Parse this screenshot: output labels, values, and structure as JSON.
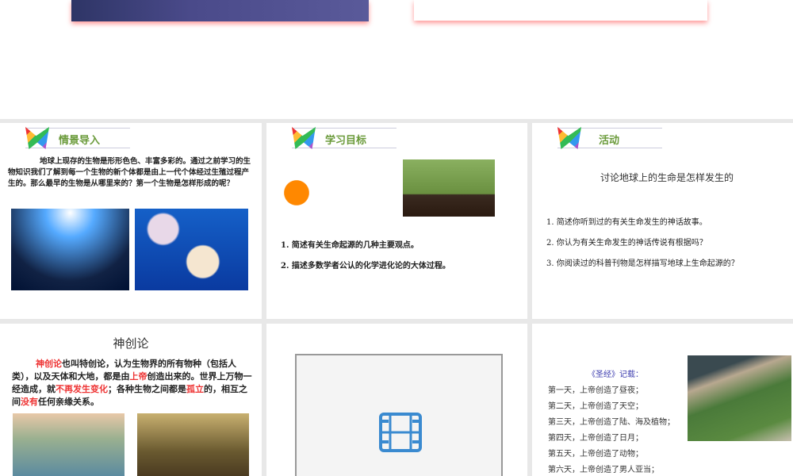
{
  "slides": {
    "s2": {
      "title": "情景导入",
      "body": "地球上现存的生物是形形色色、丰富多彩的。通过之前学习的生物知识我们了解到每一个生物的新个体都是由上一代个体经过生殖过程产生的。那么最早的生物是从哪里来的？第一个生物是怎样形成的呢？"
    },
    "s3": {
      "title": "学习目标",
      "items": [
        "1. 简述有关生命起源的几种主要观点。",
        "2. 描述多数学者公认的化学进化论的大体过程。"
      ]
    },
    "s4": {
      "title": "活动",
      "subtitle": "讨论地球上的生命是怎样发生的",
      "items": [
        "1. 简述你听到过的有关生命发生的神话故事。",
        "2. 你认为有关生命发生的神话传说有根据吗？",
        "3. 你阅读过的科普刊物是怎样描写地球上生命起源的？"
      ]
    },
    "s5": {
      "title": "神创论",
      "p1": "神创论",
      "p2": "也叫特创论，认为生物界的所有物种（包括人类），以及天体和大地，都是由",
      "p3": "上帝",
      "p4": "创造出来的。世界上万物一经造成，就",
      "p5": "不再发生变化",
      "p6": "；各种生物之间都是",
      "p7": "孤立",
      "p8": "的，相互之间",
      "p9": "没有",
      "p10": "任何亲缘关系。"
    },
    "s6": {
      "icon": "film-icon"
    },
    "s7": {
      "heading": "《圣经》记载：",
      "lines": [
        "第一天，上帝创造了昼夜；",
        "第二天，上帝创造了天空；",
        "第三天，上帝创造了陆、海及植物；",
        "第四天，上帝创造了日月；",
        "第五天，上帝创造了动物；",
        "第六天，上帝创造了男人亚当；"
      ]
    }
  }
}
